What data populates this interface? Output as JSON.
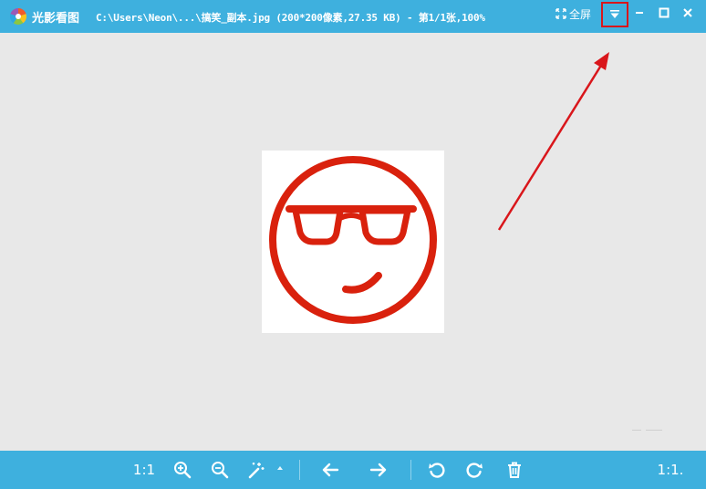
{
  "titlebar": {
    "app_name": "光影看图",
    "file_info": "C:\\Users\\Neon\\...\\搞笑_副本.jpg (200*200像素,27.35 KB) - 第1/1张,100%",
    "fullscreen_label": "全屏",
    "bg_color": "#3eb0de",
    "highlight_color": "#d9161b"
  },
  "toolbar": {
    "actual_size_label": "1:1",
    "right_ratio_label": "1:1.",
    "icons": [
      "zoom-in-icon",
      "zoom-out-icon",
      "magic-wand-icon",
      "arrow-left-icon",
      "arrow-right-icon",
      "rotate-left-icon",
      "rotate-right-icon",
      "trash-icon"
    ]
  },
  "image": {
    "face_color": "#d9210d",
    "description_icon": "cool-smiley-icon"
  }
}
